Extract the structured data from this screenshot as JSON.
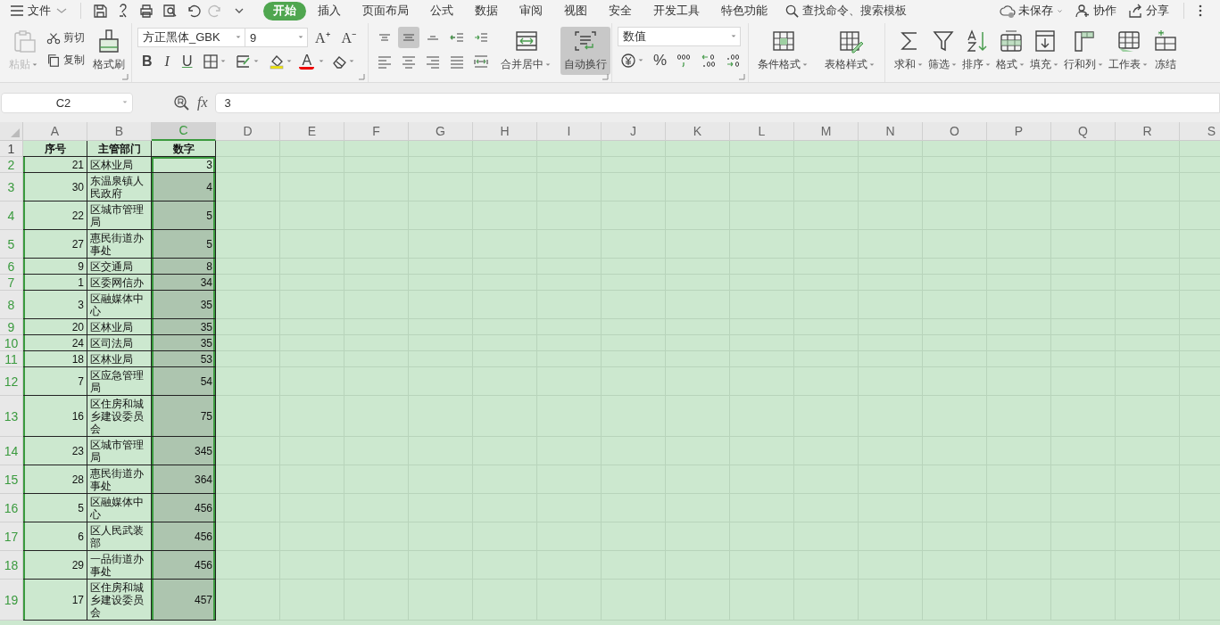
{
  "menu_bar": {
    "file_menu": "文件",
    "tabs": [
      {
        "label": "开始",
        "selected": true
      },
      {
        "label": "插入",
        "selected": false
      },
      {
        "label": "页面布局",
        "selected": false
      },
      {
        "label": "公式",
        "selected": false
      },
      {
        "label": "数据",
        "selected": false
      },
      {
        "label": "审阅",
        "selected": false
      },
      {
        "label": "视图",
        "selected": false
      },
      {
        "label": "安全",
        "selected": false
      },
      {
        "label": "开发工具",
        "selected": false
      },
      {
        "label": "特色功能",
        "selected": false
      }
    ],
    "search": {
      "placeholder": "查找命令、搜索模板"
    },
    "actions": [
      {
        "label": "未保存",
        "dropdown": true
      },
      {
        "label": "协作",
        "dropdown": false
      },
      {
        "label": "分享",
        "dropdown": false
      }
    ]
  },
  "ribbon": {
    "clipboard": {
      "paste": {
        "label": "粘贴",
        "disabled": true
      },
      "cut": "剪切",
      "copy": "复制",
      "format_painter": "格式刷"
    },
    "font": {
      "family": "方正黑体_GBK",
      "size": "9",
      "grow": "A⁺",
      "shrink": "A⁻",
      "styles": [
        "B",
        "I",
        "U"
      ],
      "font_color": "A"
    },
    "alignment": {
      "buttons": [
        {
          "on": false
        },
        {
          "on": true
        },
        {
          "on": false
        },
        {
          "on": false
        },
        {
          "on": false
        },
        {
          "on": false
        },
        {
          "on": false
        },
        {
          "on": false
        },
        {
          "on": false
        },
        {
          "on": false
        }
      ],
      "merge": {
        "label": "合并居中",
        "on": false
      },
      "wrap": {
        "label": "自动换行",
        "on": true
      }
    },
    "number": {
      "format": "数值",
      "percent": "%"
    },
    "styles": [
      {
        "label": "条件格式",
        "dropdown": true
      },
      {
        "label": "表格样式",
        "dropdown": true
      }
    ],
    "tools": [
      {
        "label": "求和",
        "dropdown": true
      },
      {
        "label": "筛选",
        "dropdown": true
      },
      {
        "label": "排序",
        "dropdown": true
      },
      {
        "label": "格式",
        "dropdown": true
      },
      {
        "label": "填充",
        "dropdown": true
      },
      {
        "label": "行和列",
        "dropdown": true
      },
      {
        "label": "工作表",
        "dropdown": true
      },
      {
        "label": "冻结",
        "dropdown": false
      }
    ]
  },
  "formula_bar": {
    "name_box": "C2",
    "fx": "fx",
    "value": "3"
  },
  "sheet": {
    "columns": [
      {
        "label": "A",
        "selected": false
      },
      {
        "label": "B",
        "selected": false
      },
      {
        "label": "C",
        "selected": true
      },
      {
        "label": "D",
        "selected": false
      },
      {
        "label": "E",
        "selected": false
      },
      {
        "label": "F",
        "selected": false
      },
      {
        "label": "G",
        "selected": false
      },
      {
        "label": "H",
        "selected": false
      },
      {
        "label": "I",
        "selected": false
      },
      {
        "label": "J",
        "selected": false
      },
      {
        "label": "K",
        "selected": false
      },
      {
        "label": "L",
        "selected": false
      },
      {
        "label": "M",
        "selected": false
      },
      {
        "label": "N",
        "selected": false
      },
      {
        "label": "O",
        "selected": false
      },
      {
        "label": "P",
        "selected": false
      },
      {
        "label": "Q",
        "selected": false
      },
      {
        "label": "R",
        "selected": false
      },
      {
        "label": "S",
        "selected": false
      }
    ],
    "rows": [
      {
        "number": "1",
        "kind": "header",
        "selected": false,
        "active": false,
        "cells": [
          "序号",
          "主管部门",
          "数字"
        ]
      },
      {
        "number": "2",
        "kind": "data",
        "selected": true,
        "active": true,
        "cells": [
          "21",
          "区林业局",
          "3"
        ]
      },
      {
        "number": "3",
        "kind": "data",
        "selected": true,
        "active": false,
        "cells": [
          "30",
          "东温泉镇人民政府",
          "4"
        ]
      },
      {
        "number": "4",
        "kind": "data",
        "selected": true,
        "active": false,
        "cells": [
          "22",
          "区城市管理局",
          "5"
        ]
      },
      {
        "number": "5",
        "kind": "data",
        "selected": true,
        "active": false,
        "cells": [
          "27",
          "惠民街道办事处",
          "5"
        ]
      },
      {
        "number": "6",
        "kind": "data",
        "selected": true,
        "active": false,
        "cells": [
          "9",
          "区交通局",
          "8"
        ]
      },
      {
        "number": "7",
        "kind": "data",
        "selected": true,
        "active": false,
        "cells": [
          "1",
          "区委网信办",
          "34"
        ]
      },
      {
        "number": "8",
        "kind": "data",
        "selected": true,
        "active": false,
        "cells": [
          "3",
          "区融媒体中心",
          "35"
        ]
      },
      {
        "number": "9",
        "kind": "data",
        "selected": true,
        "active": false,
        "cells": [
          "20",
          "区林业局",
          "35"
        ]
      },
      {
        "number": "10",
        "kind": "data",
        "selected": true,
        "active": false,
        "cells": [
          "24",
          "区司法局",
          "35"
        ]
      },
      {
        "number": "11",
        "kind": "data",
        "selected": true,
        "active": false,
        "cells": [
          "18",
          "区林业局",
          "53"
        ]
      },
      {
        "number": "12",
        "kind": "data",
        "selected": true,
        "active": false,
        "cells": [
          "7",
          "区应急管理局",
          "54"
        ]
      },
      {
        "number": "13",
        "kind": "data",
        "selected": true,
        "active": false,
        "cells": [
          "16",
          "区住房和城乡建设委员会",
          "75"
        ]
      },
      {
        "number": "14",
        "kind": "data",
        "selected": true,
        "active": false,
        "cells": [
          "23",
          "区城市管理局",
          "345"
        ]
      },
      {
        "number": "15",
        "kind": "data",
        "selected": true,
        "active": false,
        "cells": [
          "28",
          "惠民街道办事处",
          "364"
        ]
      },
      {
        "number": "16",
        "kind": "data",
        "selected": true,
        "active": false,
        "cells": [
          "5",
          "区融媒体中心",
          "456"
        ]
      },
      {
        "number": "17",
        "kind": "data",
        "selected": true,
        "active": false,
        "cells": [
          "6",
          "区人民武装部",
          "456"
        ]
      },
      {
        "number": "18",
        "kind": "data",
        "selected": true,
        "active": false,
        "cells": [
          "29",
          "一品街道办事处",
          "456"
        ]
      },
      {
        "number": "19",
        "kind": "data",
        "selected": true,
        "active": false,
        "cells": [
          "17",
          "区住房和城乡建设委员会",
          "457"
        ]
      }
    ]
  }
}
